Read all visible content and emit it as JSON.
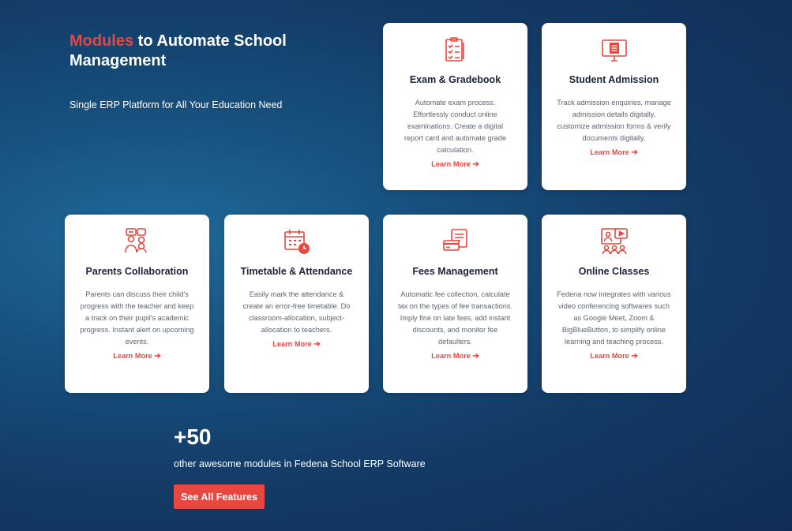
{
  "hero": {
    "title_accent": "Modules",
    "title_rest": " to Automate School Management",
    "subtitle": "Single ERP Platform for All Your Education Need"
  },
  "colors": {
    "accent": "#e8473f",
    "navy": "#1b2436",
    "background": "#133b66"
  },
  "modules": [
    {
      "icon": "exam-checklist-icon",
      "title": "Exam & Gradebook",
      "description": "Automate exam process. Effortlessly conduct online examinations. Create a digital report card and automate grade calculation.",
      "link": "Learn More"
    },
    {
      "icon": "admission-monitor-icon",
      "title": "Student Admission",
      "description": "Track admission enquiries, manage admission details digitally, customize admission forms & verify documents digitally.",
      "link": "Learn More"
    },
    {
      "icon": "parents-chat-icon",
      "title": "Parents Collaboration",
      "description": "Parents can discuss their child's progress with the teacher and keep a track on their pupil's academic progress. Instant alert on upcoming events.",
      "link": "Learn More"
    },
    {
      "icon": "calendar-clock-icon",
      "title": "Timetable & Attendance",
      "description": "Easily mark the attendance & create an error-free timetable. Do classroom-allocation, subject-allocation to teachers.",
      "link": "Learn More"
    },
    {
      "icon": "fees-card-icon",
      "title": "Fees Management",
      "description": "Automatic fee collection, calculate tax on the types of fee transactions. Imply fine on late fees, add instant discounts, and monitor fee defaulters.",
      "link": "Learn More"
    },
    {
      "icon": "online-class-icon",
      "title": "Online Classes",
      "description": "Fedena now integrates with various video conferencing softwares such as Google Meet, Zoom & BigBlueButton, to simplify online learning and teaching process.",
      "link": "Learn More"
    }
  ],
  "more": {
    "count": "+50",
    "text": "other awesome modules in Fedena School ERP Software",
    "button": "See All Features"
  }
}
